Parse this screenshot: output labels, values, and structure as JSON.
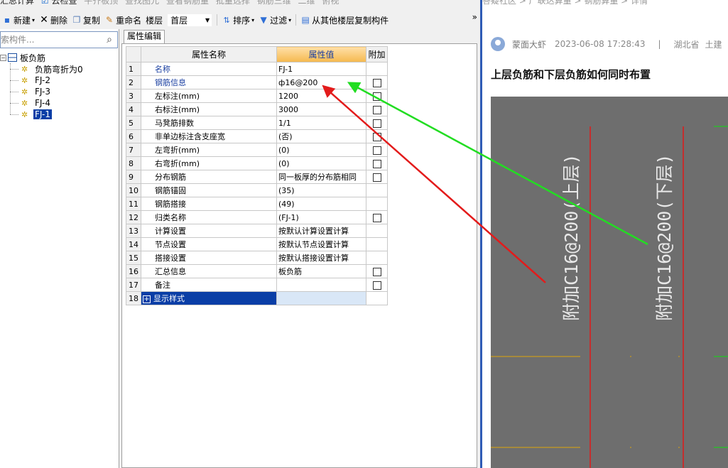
{
  "toolbar_top": {
    "items": [
      "汇总计算",
      "云检查",
      "平齐板顶",
      "查找图元",
      "查看钢筋量",
      "批量选择",
      "钢筋三维",
      "二维",
      "俯视"
    ]
  },
  "toolbar": {
    "new_label": "新建",
    "delete_label": "删除",
    "copy_label": "复制",
    "rename_label": "重命名",
    "floor_label": "楼层",
    "floor_value": "首层",
    "sort_label": "排序",
    "filter_label": "过滤",
    "copy_from_floor_label": "从其他楼层复制构件",
    "more_label": "»"
  },
  "tree": {
    "search_placeholder": "索构件...",
    "root_label": "板负筋",
    "items": [
      "负筋弯折为0",
      "FJ-2",
      "FJ-3",
      "FJ-4",
      "FJ-1"
    ],
    "selected": "FJ-1"
  },
  "props": {
    "tab_label": "属性编辑",
    "headers": {
      "name": "属性名称",
      "value": "属性值",
      "extra": "附加"
    },
    "rows": [
      {
        "num": "1",
        "name": "名称",
        "value": "FJ-1",
        "blue": true,
        "checkbox": false
      },
      {
        "num": "2",
        "name": "钢筋信息",
        "value": "ф16@200",
        "blue": true,
        "checkbox": true
      },
      {
        "num": "3",
        "name": "左标注(mm)",
        "value": "1200",
        "blue": false,
        "checkbox": true
      },
      {
        "num": "4",
        "name": "右标注(mm)",
        "value": "3000",
        "blue": false,
        "checkbox": true
      },
      {
        "num": "5",
        "name": "马凳筋排数",
        "value": "1/1",
        "blue": false,
        "checkbox": true
      },
      {
        "num": "6",
        "name": "非单边标注含支座宽",
        "value": "(否)",
        "blue": false,
        "checkbox": true
      },
      {
        "num": "7",
        "name": "左弯折(mm)",
        "value": "(0)",
        "blue": false,
        "checkbox": true
      },
      {
        "num": "8",
        "name": "右弯折(mm)",
        "value": "(0)",
        "blue": false,
        "checkbox": true
      },
      {
        "num": "9",
        "name": "分布钢筋",
        "value": "同一板厚的分布筋相同",
        "blue": false,
        "checkbox": true
      },
      {
        "num": "10",
        "name": "钢筋锚固",
        "value": "(35)",
        "blue": false,
        "checkbox": false
      },
      {
        "num": "11",
        "name": "钢筋搭接",
        "value": "(49)",
        "blue": false,
        "checkbox": false
      },
      {
        "num": "12",
        "name": "归类名称",
        "value": "(FJ-1)",
        "blue": false,
        "checkbox": true
      },
      {
        "num": "13",
        "name": "计算设置",
        "value": "按默认计算设置计算",
        "blue": false,
        "checkbox": false
      },
      {
        "num": "14",
        "name": "节点设置",
        "value": "按默认节点设置计算",
        "blue": false,
        "checkbox": false
      },
      {
        "num": "15",
        "name": "搭接设置",
        "value": "按默认搭接设置计算",
        "blue": false,
        "checkbox": false
      },
      {
        "num": "16",
        "name": "汇总信息",
        "value": "板负筋",
        "blue": false,
        "checkbox": true
      },
      {
        "num": "17",
        "name": "备注",
        "value": "",
        "blue": false,
        "checkbox": true
      }
    ],
    "group_row": {
      "num": "18",
      "expand": "+",
      "name": "显示样式"
    }
  },
  "article": {
    "breadcrumb": "答疑社区 > 广联达算量 > 钢筋算量 > 详情",
    "author": "蒙面大虾",
    "datetime": "2023-06-08 17:28:43",
    "separator": "|",
    "location": "湖北省",
    "category": "土建",
    "title": "上层负筋和下层负筋如何同时布置",
    "cad_label_left": "附加C16@200(上层)",
    "cad_label_right": "附加C16@200(下层)"
  },
  "colors": {
    "selection": "#0a3ea6",
    "header_highlight": "#f5b84e",
    "cad_background": "#6e6e6e",
    "annotation_red": "#e31b1b",
    "annotation_green": "#22dd22"
  }
}
